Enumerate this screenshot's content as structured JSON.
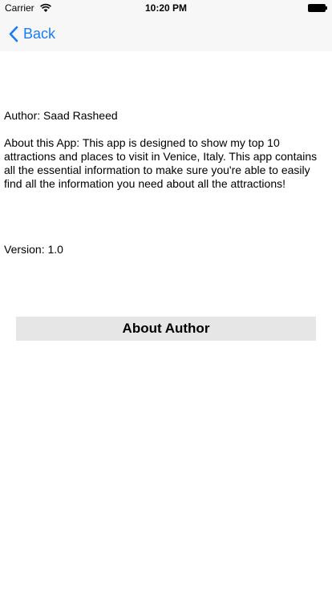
{
  "status_bar": {
    "carrier": "Carrier",
    "time": "10:20 PM",
    "icons": [
      "wifi-icon",
      "battery-icon"
    ]
  },
  "nav": {
    "back_label": "Back",
    "back_icon": "chevron-left-icon",
    "accent_color": "#1a7cf5"
  },
  "content": {
    "author": "Author: Saad Rasheed",
    "about": "About this App: This app is designed to show my top 10 attractions and places to visit in Venice, Italy. This app contains all the essential information to make sure you're able to easily find all the information you need about all the attractions!",
    "version": "Version: 1.0"
  },
  "button": {
    "about_author_label": "About Author",
    "background_color": "#e6e6e6"
  }
}
